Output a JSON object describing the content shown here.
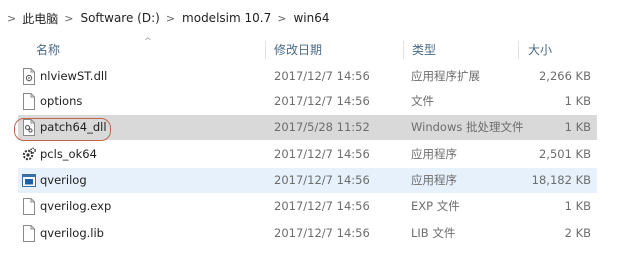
{
  "breadcrumb": {
    "items": [
      "此电脑",
      "Software (D:)",
      "modelsim 10.7",
      "win64"
    ]
  },
  "columns": {
    "name": "名称",
    "date": "修改日期",
    "type": "类型",
    "size": "大小"
  },
  "files": [
    {
      "name": "nlviewST.dll",
      "date": "2017/12/7 14:56",
      "type": "应用程序扩展",
      "size": "2,266 KB",
      "icon": "dll-file-icon"
    },
    {
      "name": "options",
      "date": "2017/12/7 14:56",
      "type": "文件",
      "size": "1 KB",
      "icon": "blank-file-icon"
    },
    {
      "name": "patch64_dll",
      "date": "2017/5/28 11:52",
      "type": "Windows 批处理文件",
      "size": "1 KB",
      "icon": "batch-file-icon"
    },
    {
      "name": "pcls_ok64",
      "date": "2017/12/7 14:56",
      "type": "应用程序",
      "size": "2,501 KB",
      "icon": "app-gear-icon"
    },
    {
      "name": "qverilog",
      "date": "2017/12/7 14:56",
      "type": "应用程序",
      "size": "18,182 KB",
      "icon": "app-window-icon"
    },
    {
      "name": "qverilog.exp",
      "date": "2017/12/7 14:56",
      "type": "EXP 文件",
      "size": "1 KB",
      "icon": "blank-file-icon"
    },
    {
      "name": "qverilog.lib",
      "date": "2017/12/7 14:56",
      "type": "LIB 文件",
      "size": "2 KB",
      "icon": "blank-file-icon"
    }
  ],
  "selected_file": "patch64_dll",
  "hovered_file": "qverilog",
  "colors": {
    "selected_row": "#d9d9d9",
    "hover_row": "#e6f1fb",
    "highlight_ring": "#c0654b",
    "header_text": "#4a6a86"
  }
}
